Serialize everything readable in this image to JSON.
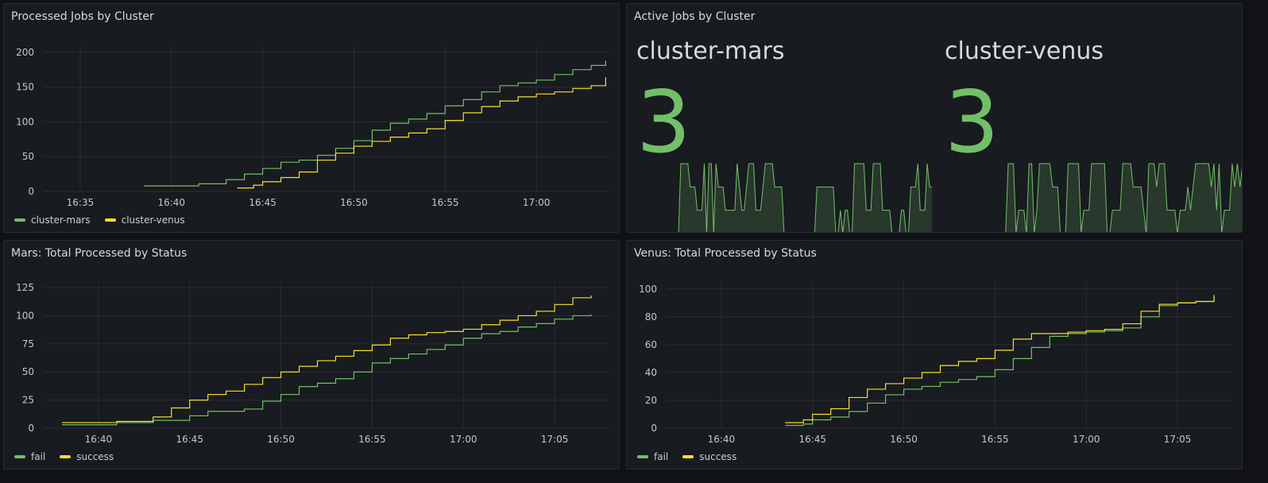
{
  "colors": {
    "green": "#73bf69",
    "yellow": "#fade2a",
    "grid": "#2a2d33",
    "axis_text": "#c7c7cf"
  },
  "panels": {
    "processed": {
      "title": "Processed Jobs by Cluster",
      "legend": [
        {
          "name": "cluster-mars",
          "color": "#73bf69"
        },
        {
          "name": "cluster-venus",
          "color": "#fade2a"
        }
      ]
    },
    "active": {
      "title": "Active Jobs by Cluster",
      "stats": [
        {
          "name": "cluster-mars",
          "value": "3",
          "color": "#73bf69"
        },
        {
          "name": "cluster-venus",
          "value": "3",
          "color": "#73bf69"
        }
      ]
    },
    "mars": {
      "title": "Mars: Total Processed by Status",
      "legend": [
        {
          "name": "fail",
          "color": "#73bf69"
        },
        {
          "name": "success",
          "color": "#fade2a"
        }
      ]
    },
    "venus": {
      "title": "Venus: Total Processed by Status",
      "legend": [
        {
          "name": "fail",
          "color": "#73bf69"
        },
        {
          "name": "success",
          "color": "#fade2a"
        }
      ]
    }
  },
  "chart_data": [
    {
      "id": "processed",
      "type": "line",
      "title": "Processed Jobs by Cluster",
      "xlim": [
        "16:33",
        "17:04"
      ],
      "xticks": [
        "16:35",
        "16:40",
        "16:45",
        "16:50",
        "16:55",
        "17:00"
      ],
      "ylim": [
        0,
        210
      ],
      "yticks": [
        0,
        50,
        100,
        150,
        200
      ],
      "grid": true,
      "legend": "bottom-left",
      "series": [
        {
          "name": "cluster-mars",
          "color": "#73bf69",
          "points": [
            [
              "16:38.5",
              8
            ],
            [
              "16:40",
              8
            ],
            [
              "16:41.5",
              11
            ],
            [
              "16:43",
              17
            ],
            [
              "16:44",
              25
            ],
            [
              "16:45",
              33
            ],
            [
              "16:46",
              42
            ],
            [
              "16:47",
              45
            ],
            [
              "16:48",
              52
            ],
            [
              "16:49",
              62
            ],
            [
              "16:50",
              73
            ],
            [
              "16:51",
              88
            ],
            [
              "16:52",
              98
            ],
            [
              "16:53",
              104
            ],
            [
              "16:54",
              112
            ],
            [
              "16:55",
              123
            ],
            [
              "16:56",
              132
            ],
            [
              "16:57",
              143
            ],
            [
              "16:58",
              152
            ],
            [
              "16:59",
              156
            ],
            [
              "17:00",
              160
            ],
            [
              "17:01",
              168
            ],
            [
              "17:02",
              175
            ],
            [
              "17:03",
              181
            ],
            [
              "17:03.8",
              188
            ]
          ]
        },
        {
          "name": "cluster-venus",
          "color": "#fade2a",
          "points": [
            [
              "16:43.6",
              5
            ],
            [
              "16:44.5",
              9
            ],
            [
              "16:45",
              14
            ],
            [
              "16:46",
              20
            ],
            [
              "16:47",
              28
            ],
            [
              "16:48",
              45
            ],
            [
              "16:49",
              55
            ],
            [
              "16:50",
              65
            ],
            [
              "16:51",
              72
            ],
            [
              "16:52",
              78
            ],
            [
              "16:53",
              84
            ],
            [
              "16:54",
              90
            ],
            [
              "16:55",
              102
            ],
            [
              "16:56",
              113
            ],
            [
              "16:57",
              122
            ],
            [
              "16:58",
              130
            ],
            [
              "16:59",
              136
            ],
            [
              "17:00",
              140
            ],
            [
              "17:01",
              143
            ],
            [
              "17:02",
              148
            ],
            [
              "17:03",
              152
            ],
            [
              "17:03.8",
              164
            ]
          ]
        }
      ]
    },
    {
      "id": "mars",
      "type": "line",
      "title": "Mars: Total Processed by Status",
      "xlim": [
        "16:37",
        "17:08"
      ],
      "xticks": [
        "16:40",
        "16:45",
        "16:50",
        "16:55",
        "17:00",
        "17:05"
      ],
      "ylim": [
        0,
        130
      ],
      "yticks": [
        0,
        25,
        50,
        75,
        100,
        125
      ],
      "grid": true,
      "legend": "bottom-left",
      "series": [
        {
          "name": "fail",
          "color": "#73bf69",
          "points": [
            [
              "16:38",
              3
            ],
            [
              "16:40",
              3
            ],
            [
              "16:41",
              5
            ],
            [
              "16:43",
              7
            ],
            [
              "16:45",
              11
            ],
            [
              "16:46",
              15
            ],
            [
              "16:48",
              17
            ],
            [
              "16:49",
              24
            ],
            [
              "16:50",
              30
            ],
            [
              "16:51",
              37
            ],
            [
              "16:52",
              40
            ],
            [
              "16:53",
              44
            ],
            [
              "16:54",
              50
            ],
            [
              "16:55",
              58
            ],
            [
              "16:56",
              62
            ],
            [
              "16:57",
              66
            ],
            [
              "16:58",
              70
            ],
            [
              "16:59",
              74
            ],
            [
              "17:00",
              80
            ],
            [
              "17:01",
              84
            ],
            [
              "17:02",
              86
            ],
            [
              "17:03",
              90
            ],
            [
              "17:04",
              93
            ],
            [
              "17:05",
              97
            ],
            [
              "17:06",
              100
            ],
            [
              "17:07",
              101
            ]
          ]
        },
        {
          "name": "success",
          "color": "#fade2a",
          "points": [
            [
              "16:38",
              5
            ],
            [
              "16:40",
              5
            ],
            [
              "16:41",
              6
            ],
            [
              "16:43",
              10
            ],
            [
              "16:44",
              18
            ],
            [
              "16:45",
              25
            ],
            [
              "16:46",
              30
            ],
            [
              "16:47",
              33
            ],
            [
              "16:48",
              39
            ],
            [
              "16:49",
              45
            ],
            [
              "16:50",
              50
            ],
            [
              "16:51",
              55
            ],
            [
              "16:52",
              60
            ],
            [
              "16:53",
              64
            ],
            [
              "16:54",
              69
            ],
            [
              "16:55",
              74
            ],
            [
              "16:56",
              80
            ],
            [
              "16:57",
              83
            ],
            [
              "16:58",
              85
            ],
            [
              "16:59",
              86
            ],
            [
              "17:00",
              88
            ],
            [
              "17:01",
              92
            ],
            [
              "17:02",
              96
            ],
            [
              "17:03",
              100
            ],
            [
              "17:04",
              104
            ],
            [
              "17:05",
              110
            ],
            [
              "17:06",
              116
            ],
            [
              "17:07",
              118
            ]
          ]
        }
      ]
    },
    {
      "id": "venus",
      "type": "line",
      "title": "Venus: Total Processed by Status",
      "xlim": [
        "16:37",
        "17:08"
      ],
      "xticks": [
        "16:40",
        "16:45",
        "16:50",
        "16:55",
        "17:00",
        "17:05"
      ],
      "ylim": [
        0,
        105
      ],
      "yticks": [
        0,
        20,
        40,
        60,
        80,
        100
      ],
      "grid": true,
      "legend": "bottom-left",
      "series": [
        {
          "name": "fail",
          "color": "#73bf69",
          "points": [
            [
              "16:43.5",
              2
            ],
            [
              "16:44.5",
              3
            ],
            [
              "16:45",
              6
            ],
            [
              "16:46",
              8
            ],
            [
              "16:47",
              12
            ],
            [
              "16:48",
              18
            ],
            [
              "16:49",
              24
            ],
            [
              "16:50",
              28
            ],
            [
              "16:51",
              30
            ],
            [
              "16:52",
              33
            ],
            [
              "16:53",
              35
            ],
            [
              "16:54",
              37
            ],
            [
              "16:55",
              42
            ],
            [
              "16:56",
              50
            ],
            [
              "16:57",
              58
            ],
            [
              "16:58",
              66
            ],
            [
              "16:59",
              68
            ],
            [
              "17:00",
              69
            ],
            [
              "17:01",
              70
            ],
            [
              "17:02",
              72
            ],
            [
              "17:03",
              80
            ],
            [
              "17:04",
              88
            ],
            [
              "17:05",
              90
            ],
            [
              "17:06",
              91
            ],
            [
              "17:07",
              96
            ]
          ]
        },
        {
          "name": "success",
          "color": "#fade2a",
          "points": [
            [
              "16:43.5",
              4
            ],
            [
              "16:44.5",
              6
            ],
            [
              "16:45",
              10
            ],
            [
              "16:46",
              14
            ],
            [
              "16:47",
              22
            ],
            [
              "16:48",
              28
            ],
            [
              "16:49",
              32
            ],
            [
              "16:50",
              36
            ],
            [
              "16:51",
              40
            ],
            [
              "16:52",
              45
            ],
            [
              "16:53",
              48
            ],
            [
              "16:54",
              50
            ],
            [
              "16:55",
              56
            ],
            [
              "16:56",
              64
            ],
            [
              "16:57",
              68
            ],
            [
              "16:58",
              68
            ],
            [
              "16:59",
              69
            ],
            [
              "17:00",
              70
            ],
            [
              "17:01",
              71
            ],
            [
              "17:02",
              75
            ],
            [
              "17:03",
              84
            ],
            [
              "17:04",
              89
            ],
            [
              "17:05",
              90
            ],
            [
              "17:06",
              91
            ],
            [
              "17:07",
              95
            ]
          ]
        }
      ]
    },
    {
      "id": "active-mars",
      "type": "area",
      "title": "cluster-mars",
      "ylim": [
        0,
        3
      ],
      "color": "#73bf69",
      "values": [
        0,
        0,
        0,
        0,
        0,
        0,
        0,
        0,
        0,
        0,
        0,
        0,
        0,
        0,
        0,
        0,
        0,
        0,
        0,
        0,
        0,
        0,
        0,
        3,
        3,
        3,
        3,
        2,
        2,
        2,
        1,
        1,
        1,
        3,
        0,
        3,
        3,
        0,
        3,
        2,
        2,
        2,
        1,
        1,
        1,
        1,
        1,
        3,
        2,
        1,
        1,
        2,
        3,
        3,
        3,
        1,
        1,
        1,
        2,
        3,
        3,
        3,
        3,
        2,
        2,
        2,
        2,
        0,
        0,
        0,
        0,
        0,
        0,
        0,
        0,
        0,
        0,
        0,
        0,
        0,
        0,
        2,
        2,
        2,
        2,
        2,
        2,
        2,
        2,
        0,
        0,
        1,
        0,
        1,
        1,
        0,
        0,
        3,
        3,
        3,
        3,
        3,
        1,
        1,
        1,
        3,
        3,
        3,
        3,
        1,
        1,
        1,
        1,
        0,
        0,
        0,
        0,
        1,
        1,
        0,
        0,
        2,
        2,
        2,
        3,
        1,
        1,
        1,
        3,
        2,
        2
      ]
    },
    {
      "id": "active-venus",
      "type": "area",
      "title": "cluster-venus",
      "ylim": [
        0,
        3
      ],
      "color": "#73bf69",
      "values": [
        0,
        0,
        0,
        0,
        0,
        0,
        0,
        0,
        0,
        0,
        0,
        0,
        0,
        0,
        0,
        0,
        0,
        0,
        0,
        0,
        0,
        0,
        0,
        0,
        0,
        0,
        0,
        0,
        0,
        3,
        3,
        3,
        0,
        1,
        1,
        1,
        0,
        3,
        3,
        0,
        1,
        3,
        3,
        3,
        3,
        3,
        2,
        2,
        2,
        0,
        0,
        0,
        3,
        3,
        3,
        3,
        3,
        0,
        1,
        1,
        1,
        3,
        3,
        3,
        3,
        3,
        3,
        0,
        0,
        1,
        1,
        1,
        1,
        3,
        3,
        3,
        3,
        2,
        2,
        2,
        2,
        1,
        0,
        3,
        3,
        3,
        2,
        3,
        3,
        3,
        1,
        1,
        1,
        1,
        0,
        1,
        1,
        1,
        2,
        1,
        2,
        3,
        3,
        3,
        3,
        3,
        3,
        2,
        3,
        1,
        3,
        0,
        1,
        1,
        1,
        3,
        2,
        3,
        2,
        3
      ]
    }
  ]
}
